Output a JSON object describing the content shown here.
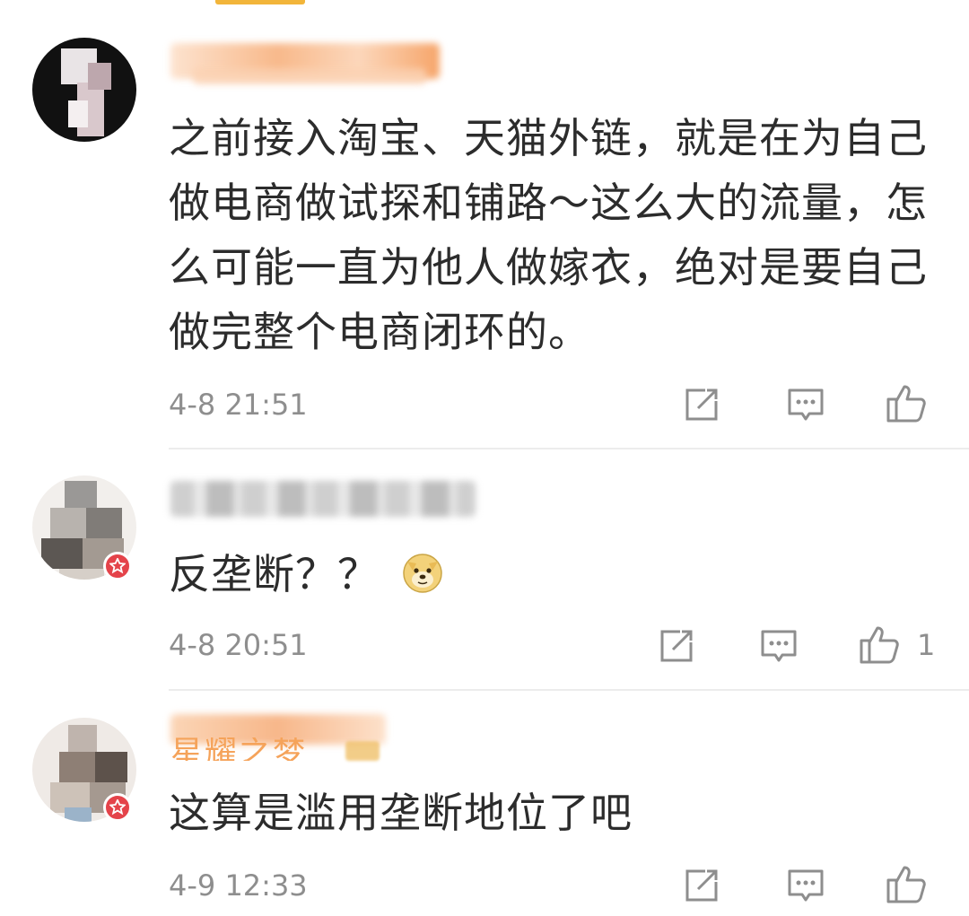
{
  "comments": [
    {
      "text": "之前接入淘宝、天猫外链，就是在为自己做电商做试探和铺路～这么大的流量，怎么可能一直为他人做嫁衣，绝对是要自己做完整个电商闭环的。",
      "time": "4-8 21:51",
      "likes": ""
    },
    {
      "text": "反垄断？？",
      "emoji": "doge-emoji",
      "time": "4-8 20:51",
      "likes": "1"
    },
    {
      "text": "这算是滥用垄断地位了吧",
      "name_partial": "星耀之梦",
      "time": "4-9 12:33",
      "likes": ""
    }
  ],
  "icons": {
    "forward": "share-edit-icon",
    "comment": "comment-bubble-icon",
    "like": "thumbs-up-icon"
  },
  "colors": {
    "verified_badge": "#e4434a",
    "name_orange": "#f5a35a",
    "time_gray": "#8e8e8e",
    "divider": "#ececec"
  }
}
